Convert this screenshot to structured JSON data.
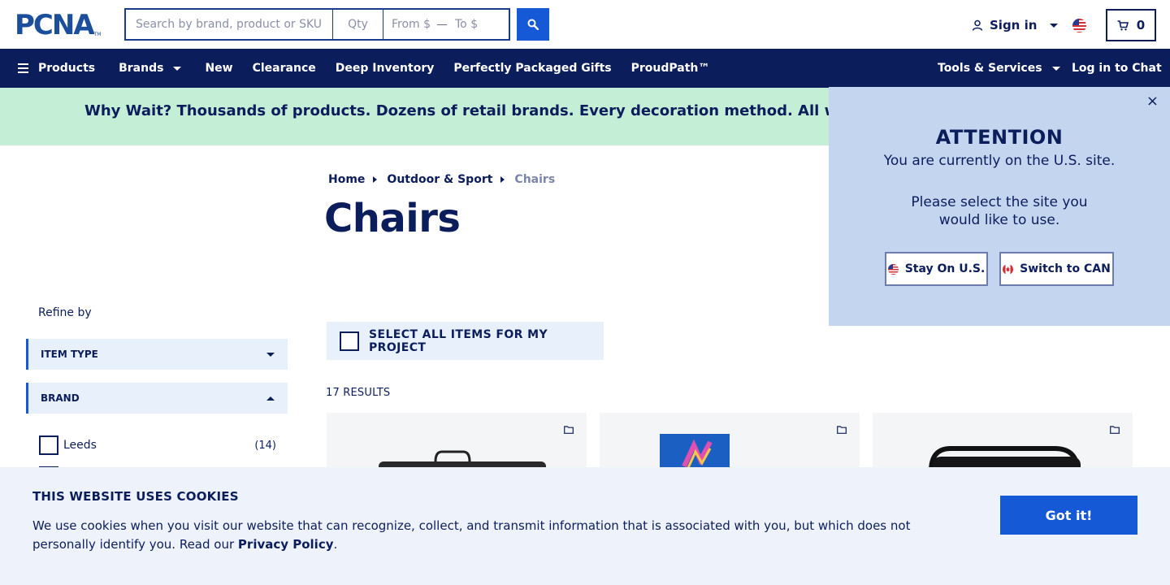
{
  "header": {
    "logo_text": "PCNA",
    "logo_tm": "TM",
    "search_placeholder": "Search by brand, product or SKU",
    "qty_placeholder": "Qty",
    "from_placeholder": "From $",
    "to_placeholder": "To $",
    "signin_label": "Sign in",
    "cart_count": "0"
  },
  "nav": {
    "items": [
      "Products",
      "Brands",
      "New",
      "Clearance",
      "Deep Inventory",
      "Perfectly Packaged Gifts",
      "ProudPath™"
    ],
    "right_items": [
      "Tools & Services",
      "Log in to Chat"
    ]
  },
  "banner": {
    "text": "Why Wait? Thousands of products. Dozens of retail brands. Every decoration method. All with a standard"
  },
  "breadcrumb": [
    "Home",
    "Outdoor & Sport",
    "Chairs"
  ],
  "page_title": "Chairs",
  "sidebar": {
    "refine_label": "Refine by",
    "facets": [
      "ITEM TYPE",
      "BRAND"
    ],
    "brand_options": [
      {
        "label": "Leeds",
        "count": "(14)"
      }
    ]
  },
  "select_all_label": "SELECT ALL ITEMS FOR MY PROJECT",
  "results_label": "17 RESULTS",
  "popup": {
    "close": "×",
    "title": "ATTENTION",
    "line1": "You are currently on the U.S. site.",
    "line2": "Please select the site you would like to use.",
    "stay_label": "Stay On U.S.",
    "switch_label": "Switch to CAN"
  },
  "cookie": {
    "title": "THIS WEBSITE USES COOKIES",
    "text": "We use cookies when you visit our website that can recognize, collect, and transmit information that is associated with you, but which does not personally identify you. Read our",
    "link": "Privacy Policy",
    "period": ".",
    "button": "Got it!"
  },
  "colors": {
    "navy": "#0c1d5c",
    "accent_blue": "#1559d6",
    "banner_green": "#c5eed6",
    "popup_blue": "#c4d5f0"
  }
}
